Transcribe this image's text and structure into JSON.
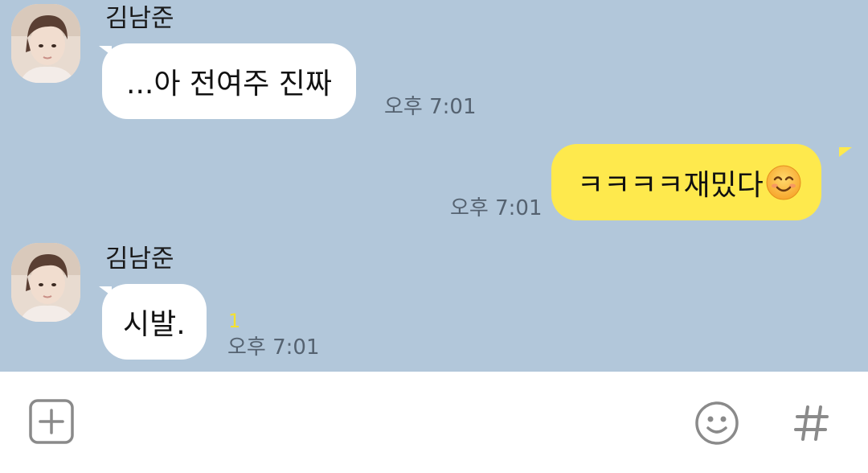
{
  "messages": [
    {
      "direction": "incoming",
      "sender": "김남준",
      "text": "...아 전여주 진짜",
      "time": "오후 7:01",
      "unread": ""
    },
    {
      "direction": "outgoing",
      "text": "ㅋㅋㅋㅋ재밌다",
      "emoji": "smiling-face-emoji",
      "time": "오후 7:01",
      "unread": ""
    },
    {
      "direction": "incoming",
      "sender": "김남준",
      "text": "시발.",
      "time": "오후 7:01",
      "unread": "1"
    }
  ],
  "input_bar": {
    "icons": [
      "plus-square-icon",
      "emoji-face-icon",
      "hashtag-icon"
    ]
  },
  "colors": {
    "chat_background": "#b2c7da",
    "outgoing_bubble": "#fee94d",
    "incoming_bubble": "#ffffff",
    "unread_count": "#f5e12e",
    "timestamp": "#556270"
  }
}
